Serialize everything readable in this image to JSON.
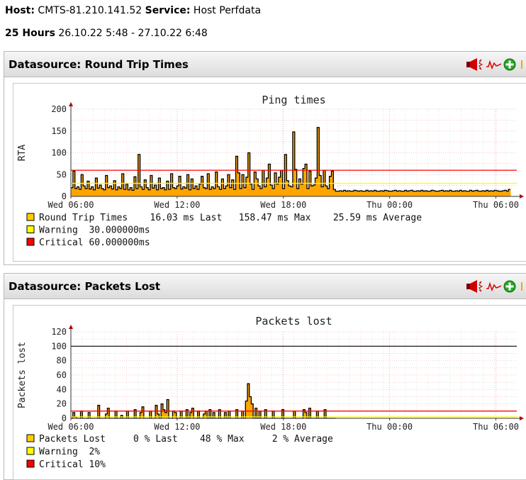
{
  "header": {
    "host_label": "Host:",
    "host_value": "CMTS-81.210.141.52",
    "service_label": "Service:",
    "service_value": "Host Perfdata",
    "range_label": "25 Hours",
    "range_value": "26.10.22 5:48 - 27.10.22 6:48"
  },
  "panels": [
    {
      "title": "Datasource: Round Trip Times",
      "icons": [
        "speaker-icon",
        "sparkline-icon",
        "add-icon"
      ]
    },
    {
      "title": "Datasource: Packets Lost",
      "icons": [
        "speaker-icon",
        "sparkline-icon",
        "add-icon"
      ]
    }
  ],
  "chart_data": [
    {
      "type": "area",
      "title": "Ping times",
      "ylabel": "RTA",
      "xlabel": "",
      "x_ticks": [
        "Wed 06:00",
        "Wed 12:00",
        "Wed 18:00",
        "Thu 00:00",
        "Thu 06:00"
      ],
      "y_ticks": [
        0,
        50,
        100,
        150,
        200
      ],
      "ylim": [
        0,
        200
      ],
      "grid": true,
      "legend_position": "bottom",
      "thresholds": {
        "warning": 30,
        "critical": 60
      },
      "colors": {
        "area": "#ffa500",
        "outline": "#000000",
        "warning": "#ffff00",
        "critical": "#ff0000"
      },
      "legend": [
        {
          "swatch": "#ffcc00",
          "text": "Round Trip Times    16.03 ms Last   158.47 ms Max    25.59 ms Average"
        },
        {
          "swatch": "#ffff00",
          "text": "Warning  30.000000ms"
        },
        {
          "swatch": "#ff0000",
          "text": "Critical 60.000000ms"
        }
      ],
      "series": [
        {
          "name": "Round Trip Times",
          "values": [
            20,
            58,
            18,
            22,
            16,
            50,
            24,
            18,
            35,
            17,
            22,
            15,
            42,
            19,
            26,
            18,
            15,
            48,
            20,
            24,
            17,
            36,
            15,
            22,
            18,
            52,
            16,
            28,
            15,
            20,
            14,
            45,
            18,
            96,
            22,
            16,
            38,
            20,
            15,
            48,
            19,
            26,
            15,
            42,
            18,
            20,
            15,
            35,
            16,
            52,
            20,
            18,
            24,
            46,
            17,
            22,
            19,
            50,
            15,
            40,
            18,
            24,
            16,
            28,
            46,
            20,
            18,
            52,
            16,
            22,
            18,
            56,
            22,
            16,
            40,
            18,
            24,
            50,
            20,
            38,
            16,
            92,
            54,
            18,
            50,
            20,
            44,
            100,
            28,
            16,
            56,
            40,
            24,
            18,
            60,
            22,
            42,
            74,
            26,
            18,
            54,
            28,
            44,
            60,
            18,
            96,
            36,
            24,
            22,
            148,
            62,
            18,
            40,
            28,
            64,
            74,
            18,
            58,
            24,
            26,
            42,
            158,
            48,
            22,
            60,
            24,
            18,
            46,
            58,
            16,
            12,
            12,
            13,
            12,
            14,
            12,
            13,
            12,
            12,
            14,
            13,
            12,
            13,
            12,
            12,
            14,
            12,
            13,
            12,
            14,
            12,
            12,
            13,
            12,
            14,
            13,
            12,
            12,
            13,
            14,
            12,
            13,
            12,
            12,
            14,
            12,
            13,
            14,
            12,
            12,
            13,
            12,
            14,
            12,
            13,
            12,
            12,
            14,
            13,
            12,
            12,
            13,
            14,
            12,
            13,
            12,
            14,
            12,
            12,
            13,
            12,
            14,
            12,
            13,
            12,
            12,
            14,
            12,
            13,
            14,
            12,
            12,
            13,
            12,
            14,
            12,
            13,
            12,
            14,
            13,
            12,
            12,
            13,
            14,
            12,
            16
          ]
        }
      ]
    },
    {
      "type": "area",
      "title": "Packets lost",
      "ylabel": "Packets lost",
      "xlabel": "",
      "x_ticks": [
        "Wed 06:00",
        "Wed 12:00",
        "Wed 18:00",
        "Thu 00:00",
        "Thu 06:00"
      ],
      "y_ticks": [
        0,
        20,
        40,
        60,
        80,
        100,
        120
      ],
      "ylim": [
        0,
        120
      ],
      "grid": true,
      "legend_position": "bottom",
      "thresholds": {
        "warning": 2,
        "critical": 10,
        "max": 100
      },
      "colors": {
        "area": "#ffa500",
        "outline": "#000000",
        "warning": "#ffff00",
        "critical": "#ff0000"
      },
      "legend": [
        {
          "swatch": "#ffcc00",
          "text": "Packets Lost     0 % Last    48 % Max     2 % Average"
        },
        {
          "swatch": "#ffff00",
          "text": "Warning  2%"
        },
        {
          "swatch": "#ff0000",
          "text": "Critical 10%"
        }
      ],
      "series": [
        {
          "name": "Packets Lost",
          "values": [
            0,
            8,
            2,
            0,
            0,
            10,
            0,
            0,
            0,
            8,
            0,
            0,
            0,
            0,
            18,
            0,
            0,
            0,
            6,
            14,
            0,
            0,
            0,
            10,
            0,
            0,
            4,
            0,
            0,
            10,
            0,
            0,
            0,
            12,
            0,
            0,
            8,
            16,
            0,
            0,
            0,
            10,
            0,
            0,
            18,
            6,
            0,
            20,
            12,
            8,
            26,
            0,
            0,
            10,
            8,
            0,
            0,
            10,
            0,
            0,
            12,
            0,
            8,
            14,
            0,
            0,
            10,
            0,
            0,
            6,
            10,
            0,
            12,
            0,
            8,
            0,
            0,
            12,
            0,
            0,
            8,
            0,
            10,
            0,
            0,
            0,
            12,
            0,
            0,
            10,
            0,
            24,
            48,
            30,
            20,
            0,
            14,
            0,
            10,
            0,
            0,
            12,
            0,
            0,
            0,
            10,
            0,
            0,
            0,
            0,
            12,
            0,
            0,
            0,
            0,
            0,
            10,
            0,
            0,
            0,
            0,
            12,
            8,
            0,
            14,
            0,
            0,
            0,
            10,
            0,
            0,
            0,
            12,
            0,
            0,
            0,
            0,
            0
          ]
        }
      ]
    }
  ]
}
